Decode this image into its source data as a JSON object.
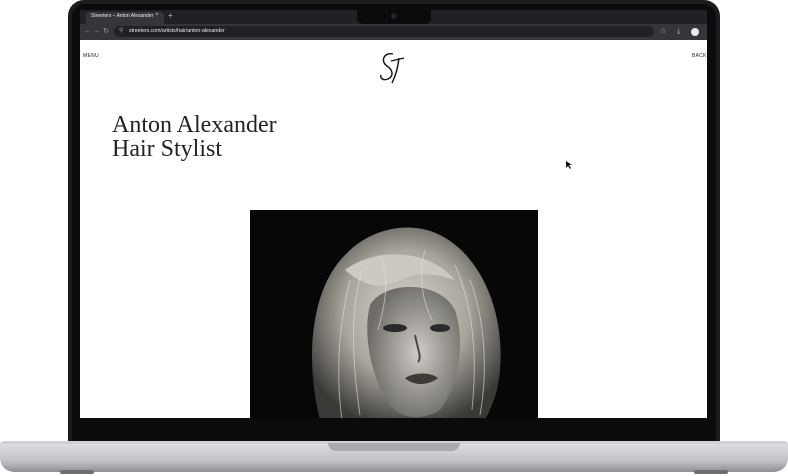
{
  "browser": {
    "tab_title": "Streeters – Anton Alexander",
    "tab_close": "×",
    "new_tab": "+",
    "nav_back": "←",
    "nav_forward": "→",
    "reload": "↻",
    "url": "streeters.com/artists/hair/anton-alexander",
    "bookmark_icon": "☆",
    "download_icon": "⤓"
  },
  "page": {
    "menu_label": "MENU",
    "back_label": "BACK",
    "artist_name": "Anton Alexander",
    "artist_role": "Hair Stylist"
  },
  "colors": {
    "tab_strip": "#202124",
    "toolbar": "#35363a",
    "page_background": "#ffffff",
    "heading_text": "#222222",
    "photo_background": "#070707"
  }
}
